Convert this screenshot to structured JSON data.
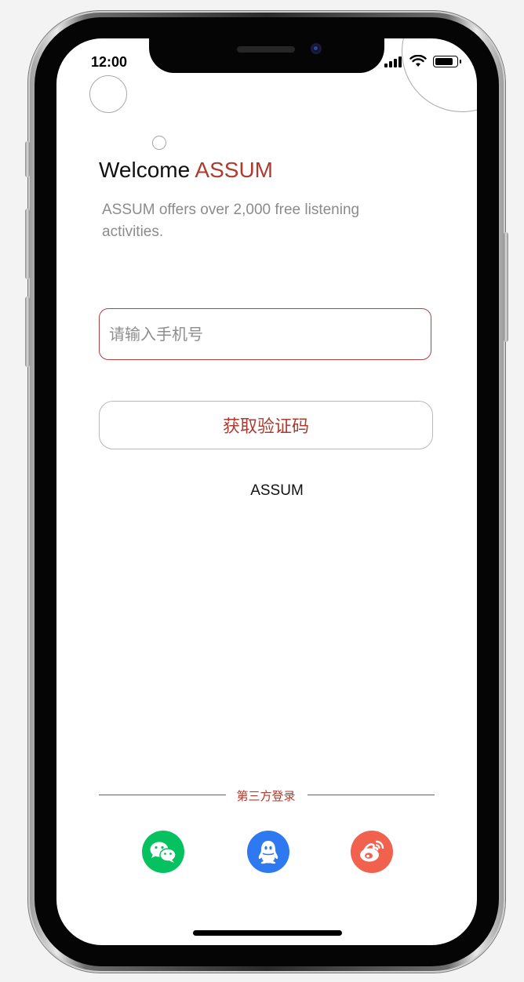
{
  "status_bar": {
    "time": "12:00"
  },
  "header": {
    "welcome_prefix": "Welcome",
    "brand": "ASSUM",
    "subtitle": "ASSUM offers over 2,000 free listening activities."
  },
  "form": {
    "phone_placeholder": "请输入手机号",
    "phone_value": "",
    "get_code_label": "获取验证码"
  },
  "brand_caption": "ASSUM",
  "third_party": {
    "label": "第三方登录",
    "providers": [
      {
        "name": "WeChat",
        "icon": "wechat-icon",
        "color": "#06c160"
      },
      {
        "name": "QQ",
        "icon": "qq-icon",
        "color": "#2e79f0"
      },
      {
        "name": "Weibo",
        "icon": "weibo-icon",
        "color": "#f0614e"
      }
    ]
  },
  "colors": {
    "accent": "#b03a2e",
    "input_border": "#b0413e"
  }
}
